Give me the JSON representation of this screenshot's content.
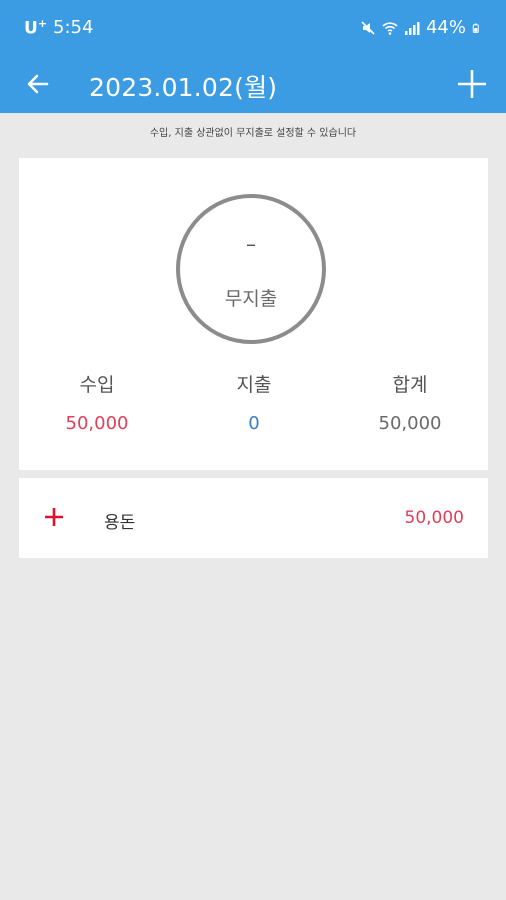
{
  "colors": {
    "primary": "#3b9be3",
    "income": "#e0405a",
    "expense": "#3b7dc4",
    "total": "#6a6a6a",
    "background": "#e9e9e9"
  },
  "status_bar": {
    "carrier": "U",
    "carrier_sup": "+",
    "time": "5:54",
    "battery": "44%",
    "icons": [
      "mute-icon",
      "wifi-icon",
      "signal-icon",
      "battery-icon"
    ]
  },
  "app_bar": {
    "title": "2023.01.02(월)",
    "back_icon": "arrow-left-icon",
    "add_icon": "plus-icon"
  },
  "hint": "수입, 지출 상관없이 무지출로 설정할 수 있습니다",
  "summary": {
    "circle_value": "–",
    "circle_label": "무지출",
    "income_label": "수입",
    "income_value": "50,000",
    "expense_label": "지출",
    "expense_value": "0",
    "total_label": "합계",
    "total_value": "50,000"
  },
  "entries": [
    {
      "type_icon": "plus-icon",
      "label": "용돈",
      "amount": "50,000"
    }
  ]
}
